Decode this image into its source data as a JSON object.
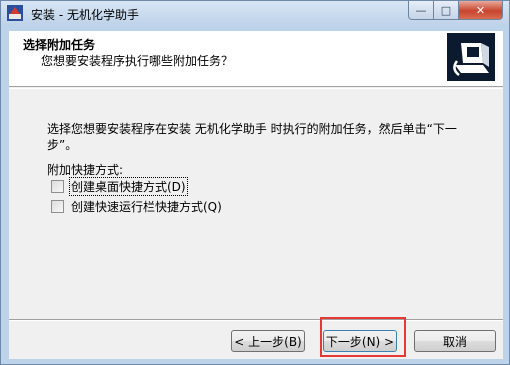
{
  "window": {
    "title": "安装 - 无机化学助手",
    "caption_buttons": {
      "minimize": "—",
      "maximize": "□",
      "close": "✕"
    }
  },
  "header": {
    "title": "选择附加任务",
    "subtitle": "您想要安装程序执行哪些附加任务？"
  },
  "body": {
    "instruction": "选择您想要安装程序在安装 无机化学助手 时执行的附加任务，然后单击“下一步”。",
    "group_label": "附加快捷方式:",
    "checkboxes": [
      {
        "label": "创建桌面快捷方式(D)",
        "checked": false
      },
      {
        "label": "创建快速运行栏快捷方式(Q)",
        "checked": false
      }
    ]
  },
  "buttons": {
    "back": "< 上一步(B)",
    "next": "下一步(N) >",
    "cancel": "取消"
  },
  "colors": {
    "highlight": "#e53935",
    "title_bar": "#bed2e9"
  }
}
